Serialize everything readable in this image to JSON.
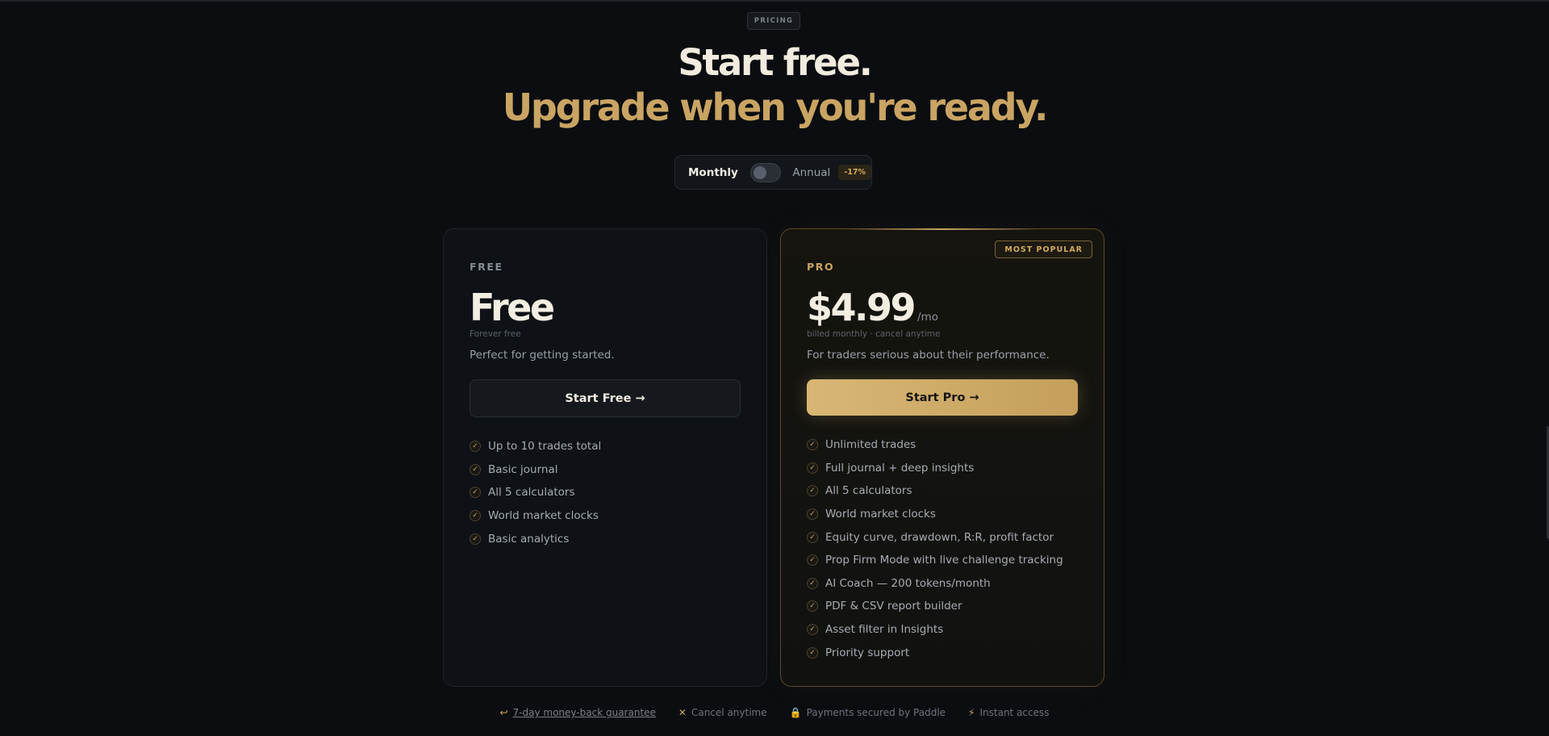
{
  "eyebrow": "PRICING",
  "headline": {
    "line1": "Start free.",
    "line2": "Upgrade when you're ready."
  },
  "billing": {
    "monthly": "Monthly",
    "annual": "Annual",
    "discount": "-17%",
    "selected": "monthly"
  },
  "plans": {
    "free": {
      "tier": "FREE",
      "price": "Free",
      "note": "Forever free",
      "description": "Perfect for getting started.",
      "cta": "Start Free →",
      "features": [
        "Up to 10 trades total",
        "Basic journal",
        "All 5 calculators",
        "World market clocks",
        "Basic analytics"
      ]
    },
    "pro": {
      "badge": "MOST POPULAR",
      "tier": "PRO",
      "price": "$4.99",
      "period": "/mo",
      "note": "billed monthly · cancel anytime",
      "description": "For traders serious about their performance.",
      "cta": "Start Pro →",
      "features": [
        "Unlimited trades",
        "Full journal + deep insights",
        "All 5 calculators",
        "World market clocks",
        "Equity curve, drawdown, R:R, profit factor",
        "Prop Firm Mode with live challenge tracking",
        "AI Coach — 200 tokens/month",
        "PDF & CSV report builder",
        "Asset filter in Insights",
        "Priority support"
      ]
    }
  },
  "footer": {
    "guarantee": "7-day money-back guarantee",
    "cancel": "Cancel anytime",
    "secure": "Payments secured by Paddle",
    "instant": "Instant access"
  },
  "colors": {
    "accent": "#c9a463",
    "background": "#0b0d10"
  }
}
